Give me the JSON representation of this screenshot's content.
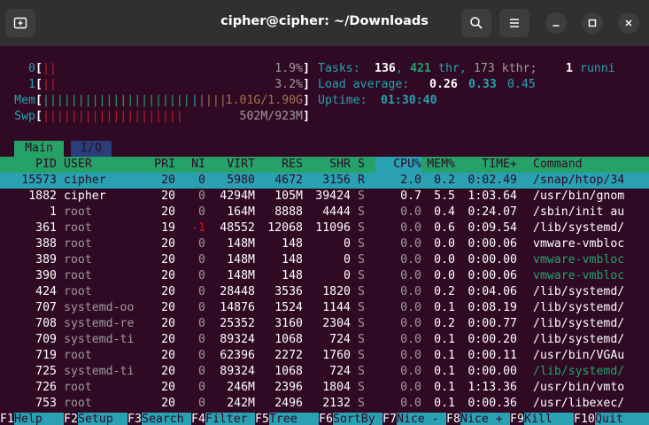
{
  "window": {
    "title": "cipher@cipher: ~/Downloads"
  },
  "meters": {
    "cpu0": {
      "label": "0",
      "bars": "||",
      "value": "1.9%"
    },
    "cpu1": {
      "label": "1",
      "bars": "||",
      "value": "3.2%"
    },
    "mem": {
      "label": "Mem",
      "bars_green": "|||||||||||||||||||||",
      "bars_blue": "|",
      "bars_orange": "||||",
      "value": "1.01G/1.90G"
    },
    "swp": {
      "label": "Swp",
      "bars": "||||||||||||||||||||",
      "value": "502M/923M"
    }
  },
  "summary": {
    "tasks_label": "Tasks:",
    "tasks": "136",
    "thr": "421",
    "thr_label": "thr,",
    "kthr": "173 kthr;",
    "running": "1",
    "running_label": "runni",
    "load_label": "Load average:",
    "load1": "0.26",
    "load5": "0.33",
    "load15": "0.45",
    "uptime_label": "Uptime:",
    "uptime": "01:30:40"
  },
  "tabs": [
    {
      "label": "Main"
    },
    {
      "label": "I/O"
    }
  ],
  "columns": [
    "PID",
    "USER",
    "PRI",
    "NI",
    "VIRT",
    "RES",
    "SHR",
    "S",
    "CPU%",
    "MEM%",
    "TIME+",
    "Command"
  ],
  "rows": [
    {
      "pid": "15573",
      "user": "cipher",
      "pri": "20",
      "ni": "0",
      "virt": "5980",
      "res": "4672",
      "shr": "3156",
      "s": "R",
      "cpu": "2.0",
      "mem": "0.2",
      "time": "0:02.49",
      "cmd": "/snap/htop/34"
    },
    {
      "pid": "1882",
      "user": "cipher",
      "pri": "20",
      "ni": "0",
      "virt": "4294M",
      "res": "105M",
      "shr": "39424",
      "s": "S",
      "cpu": "0.7",
      "mem": "5.5",
      "time": "1:03.64",
      "cmd": "/usr/bin/gnom"
    },
    {
      "pid": "1",
      "user": "root",
      "pri": "20",
      "ni": "0",
      "virt": "164M",
      "res": "8888",
      "shr": "4444",
      "s": "S",
      "cpu": "0.0",
      "mem": "0.4",
      "time": "0:24.07",
      "cmd": "/sbin/init au"
    },
    {
      "pid": "361",
      "user": "root",
      "pri": "19",
      "ni": "-1",
      "virt": "48552",
      "res": "12068",
      "shr": "11096",
      "s": "S",
      "cpu": "0.0",
      "mem": "0.6",
      "time": "0:09.54",
      "cmd": "/lib/systemd/"
    },
    {
      "pid": "388",
      "user": "root",
      "pri": "20",
      "ni": "0",
      "virt": "148M",
      "res": "148",
      "shr": "0",
      "s": "S",
      "cpu": "0.0",
      "mem": "0.0",
      "time": "0:00.06",
      "cmd": "vmware-vmbloc"
    },
    {
      "pid": "389",
      "user": "root",
      "pri": "20",
      "ni": "0",
      "virt": "148M",
      "res": "148",
      "shr": "0",
      "s": "S",
      "cpu": "0.0",
      "mem": "0.0",
      "time": "0:00.00",
      "cmd": "vmware-vmbloc"
    },
    {
      "pid": "390",
      "user": "root",
      "pri": "20",
      "ni": "0",
      "virt": "148M",
      "res": "148",
      "shr": "0",
      "s": "S",
      "cpu": "0.0",
      "mem": "0.0",
      "time": "0:00.06",
      "cmd": "vmware-vmbloc"
    },
    {
      "pid": "424",
      "user": "root",
      "pri": "20",
      "ni": "0",
      "virt": "28448",
      "res": "3536",
      "shr": "1820",
      "s": "S",
      "cpu": "0.0",
      "mem": "0.2",
      "time": "0:04.06",
      "cmd": "/lib/systemd/"
    },
    {
      "pid": "707",
      "user": "systemd-oo",
      "pri": "20",
      "ni": "0",
      "virt": "14876",
      "res": "1524",
      "shr": "1144",
      "s": "S",
      "cpu": "0.0",
      "mem": "0.1",
      "time": "0:08.19",
      "cmd": "/lib/systemd/"
    },
    {
      "pid": "708",
      "user": "systemd-re",
      "pri": "20",
      "ni": "0",
      "virt": "25352",
      "res": "3160",
      "shr": "2304",
      "s": "S",
      "cpu": "0.0",
      "mem": "0.2",
      "time": "0:00.77",
      "cmd": "/lib/systemd/"
    },
    {
      "pid": "709",
      "user": "systemd-ti",
      "pri": "20",
      "ni": "0",
      "virt": "89324",
      "res": "1068",
      "shr": "724",
      "s": "S",
      "cpu": "0.0",
      "mem": "0.1",
      "time": "0:00.20",
      "cmd": "/lib/systemd/"
    },
    {
      "pid": "719",
      "user": "root",
      "pri": "20",
      "ni": "0",
      "virt": "62396",
      "res": "2272",
      "shr": "1760",
      "s": "S",
      "cpu": "0.0",
      "mem": "0.1",
      "time": "0:00.11",
      "cmd": "/usr/bin/VGAu"
    },
    {
      "pid": "725",
      "user": "systemd-ti",
      "pri": "20",
      "ni": "0",
      "virt": "89324",
      "res": "1068",
      "shr": "724",
      "s": "S",
      "cpu": "0.0",
      "mem": "0.1",
      "time": "0:00.00",
      "cmd": "/lib/systemd/"
    },
    {
      "pid": "726",
      "user": "root",
      "pri": "20",
      "ni": "0",
      "virt": "246M",
      "res": "2396",
      "shr": "1804",
      "s": "S",
      "cpu": "0.0",
      "mem": "0.1",
      "time": "1:13.36",
      "cmd": "/usr/bin/vmto"
    },
    {
      "pid": "753",
      "user": "root",
      "pri": "20",
      "ni": "0",
      "virt": "242M",
      "res": "2496",
      "shr": "2132",
      "s": "S",
      "cpu": "0.0",
      "mem": "0.1",
      "time": "0:00.36",
      "cmd": "/usr/libexec/"
    }
  ],
  "fkeys": [
    {
      "num": "F1",
      "label": "Help"
    },
    {
      "num": "F2",
      "label": "Setup"
    },
    {
      "num": "F3",
      "label": "Search"
    },
    {
      "num": "F4",
      "label": "Filter"
    },
    {
      "num": "F5",
      "label": "Tree"
    },
    {
      "num": "F6",
      "label": "SortBy"
    },
    {
      "num": "F7",
      "label": "Nice -"
    },
    {
      "num": "F8",
      "label": "Nice +"
    },
    {
      "num": "F9",
      "label": "Kill"
    },
    {
      "num": "F10",
      "label": "Quit"
    }
  ],
  "colors": {
    "background": "#300a24",
    "titlebar": "#303030",
    "header_green": "#26a269",
    "cyan": "#2aa1b3",
    "red": "#c01c28"
  }
}
